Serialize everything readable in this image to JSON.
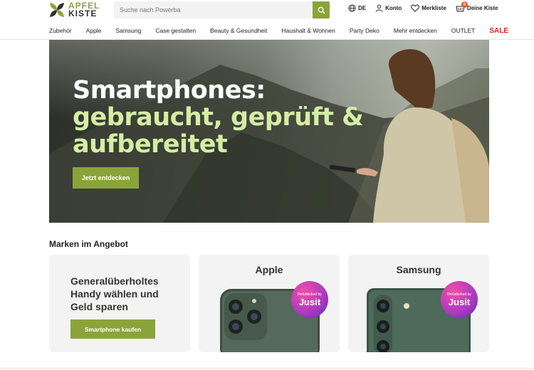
{
  "header": {
    "logo_line1": "APFEL",
    "logo_line2": "KISTE",
    "search_placeholder": "Suche nach Powerba",
    "language": "DE",
    "account": "Konto",
    "wishlist": "Merkliste",
    "cart": "Deine Kiste",
    "cart_count": "0"
  },
  "nav": {
    "items": [
      "Zubehör",
      "Apple",
      "Samsung",
      "Case gestalten",
      "Beauty & Gesundheit",
      "Haushalt & Wohnen",
      "Party Deko",
      "Mehr entdecken",
      "OUTLET",
      "SALE"
    ]
  },
  "hero": {
    "title_line1": "Smartphones:",
    "title_line2": "gebraucht, geprüft &",
    "title_line3": "aufbereitet",
    "cta": "Jetzt entdecken"
  },
  "brands": {
    "section_title": "Marken im Angebot",
    "promo_text": "Generalüberholtes Handy wählen und Geld sparen",
    "promo_button": "Smartphone kaufen",
    "card2_title": "Apple",
    "card3_title": "Samsung",
    "seal_top": "Refurbished by",
    "seal_brand": "Jusit"
  },
  "colors": {
    "accent": "#8aa43a",
    "hero_highlight": "#d4eea5",
    "sale": "#d7261e"
  }
}
